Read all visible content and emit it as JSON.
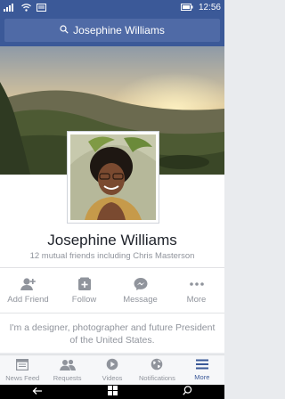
{
  "status": {
    "time": "12:56"
  },
  "search": {
    "query": "Josephine Williams"
  },
  "profile": {
    "name": "Josephine Williams",
    "mutual": "12 mutual friends including Chris Masterson",
    "bio": "I'm a designer, photographer and future President of the United States."
  },
  "actions": [
    {
      "label": "Add Friend",
      "icon": "add-friend-icon"
    },
    {
      "label": "Follow",
      "icon": "follow-icon"
    },
    {
      "label": "Message",
      "icon": "messenger-icon"
    },
    {
      "label": "More",
      "icon": "more-icon"
    }
  ],
  "tabs": [
    {
      "label": "News Feed",
      "icon": "news-feed-icon"
    },
    {
      "label": "Requests",
      "icon": "requests-icon"
    },
    {
      "label": "Videos",
      "icon": "videos-icon"
    },
    {
      "label": "Notifications",
      "icon": "globe-icon"
    },
    {
      "label": "More",
      "icon": "menu-icon",
      "active": true
    }
  ],
  "colors": {
    "brand": "#3b5998",
    "muted": "#90949c"
  }
}
